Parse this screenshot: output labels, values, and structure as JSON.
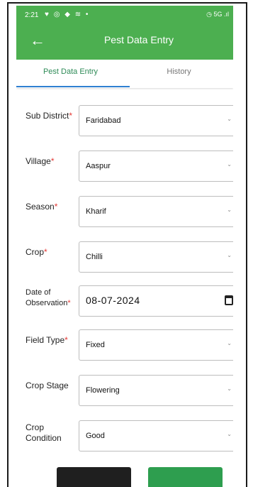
{
  "status": {
    "time": "2:21",
    "left_icons": "♥ ◎ ◆ ≋ •",
    "right_icons": "◷ 5G .ıl"
  },
  "appbar": {
    "title": "Pest Data Entry"
  },
  "tabs": [
    {
      "label": "Pest Data Entry",
      "active": true
    },
    {
      "label": "History",
      "active": false
    }
  ],
  "form": {
    "required_mark": "*",
    "fields": [
      {
        "label": "Sub District",
        "required": true,
        "value": "Faridabad"
      },
      {
        "label": "Village",
        "required": true,
        "value": "Aaspur"
      },
      {
        "label": "Season",
        "required": true,
        "value": "Kharif"
      },
      {
        "label": "Crop",
        "required": true,
        "value": "Chilli"
      },
      {
        "label_line1": "Date of",
        "label_line2": "Observation",
        "required": true,
        "value": "08-07-2024"
      },
      {
        "label": "Field Type",
        "required": true,
        "value": "Fixed"
      },
      {
        "label": "Crop Stage",
        "required": false,
        "value": "Flowering"
      },
      {
        "label_line1": "Crop",
        "label_line2": "Condition",
        "required": false,
        "value": "Good"
      }
    ]
  },
  "colors": {
    "header_green": "#4caf50",
    "tab_active": "#2e8b57",
    "tab_indicator": "#2f80d1",
    "required": "#e53935"
  }
}
